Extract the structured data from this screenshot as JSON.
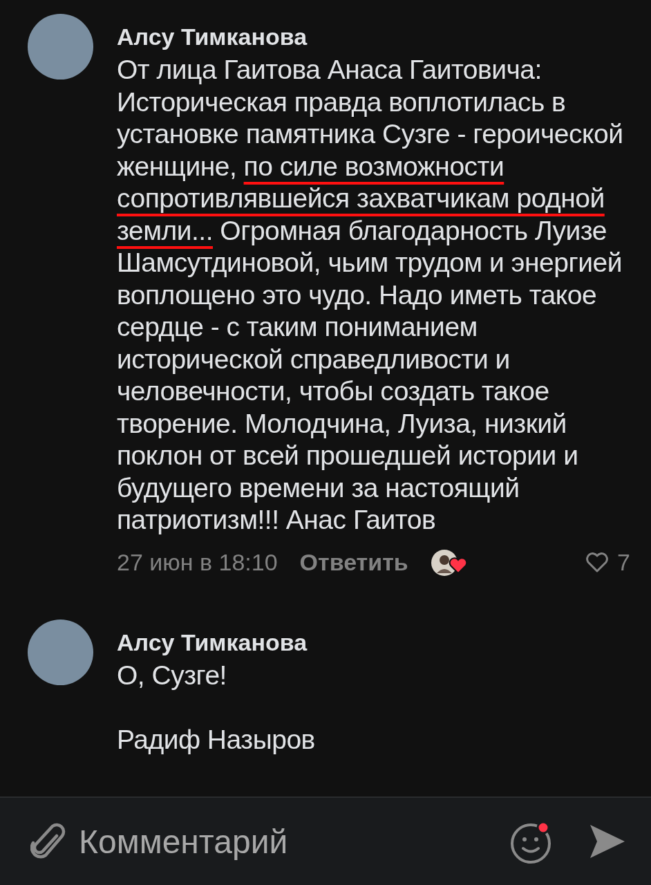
{
  "comments": [
    {
      "author": "Алсу Тимканова",
      "segments": [
        {
          "text": "От лица Гаитова Анаса Гаитовича: Историческая правда воплотилась в установке памятника Сузге - героической женщине, ",
          "underlined": false
        },
        {
          "text": "по силе возможности сопротивлявшейся захватчикам родной земли...",
          "underlined": true
        },
        {
          "text": " Огромная благодарность Луизе Шамсутдиновой, чьим трудом и энергией воплощено это чудо. Надо иметь такое сердце - с таким  пониманием исторической справедливости и человечности, чтобы создать такое творение. Молодчина, Луиза, низкий поклон от всей прошедшей истории и будущего времени за настоящий патриотизм!!! Анас Гаитов",
          "underlined": false
        }
      ],
      "date": "27 июн в 18:10",
      "reply": "Ответить",
      "reacted": true,
      "likes": "7"
    },
    {
      "author": "Алсу Тимканова",
      "segments": [
        {
          "text": "О, Сузге!\n\nРадиф Назыров",
          "underlined": false
        }
      ]
    }
  ],
  "composer": {
    "placeholder": "Комментарий",
    "emoji_notification": true
  }
}
